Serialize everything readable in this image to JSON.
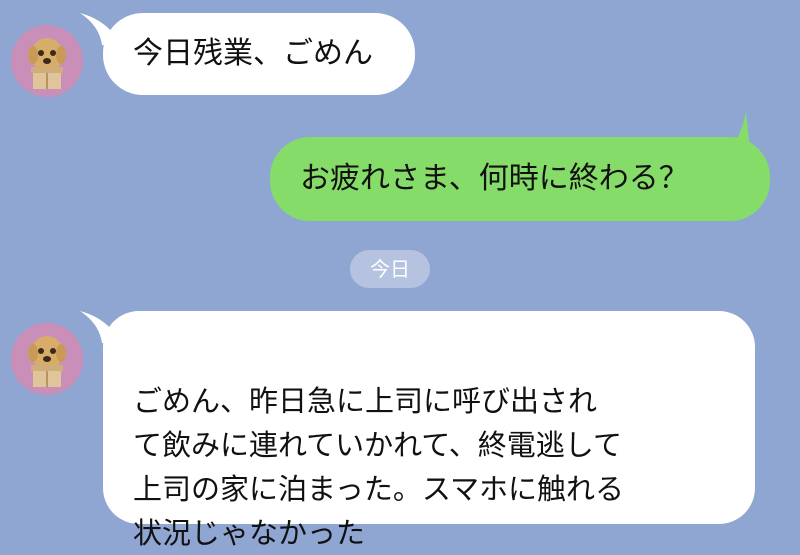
{
  "chat": {
    "messages": [
      {
        "sender": "other",
        "text": "今日残業、ごめん"
      },
      {
        "sender": "me",
        "text": "お疲れさま、何時に終わる？"
      },
      {
        "sender": "other",
        "text": "ごめん、昨日急に上司に呼び出され\nて飲みに連れていかれて、終電逃して\n上司の家に泊まった。スマホに触れる\n状況じゃなかった"
      }
    ],
    "date_separator": "今日"
  },
  "colors": {
    "background": "#8fa6d2",
    "incoming_bubble": "#ffffff",
    "outgoing_bubble": "#86dc69",
    "avatar_bg": "#c98fb8",
    "date_pill": "#b5c3e0"
  },
  "icons": {
    "avatar": "dog-in-box-avatar-icon"
  }
}
